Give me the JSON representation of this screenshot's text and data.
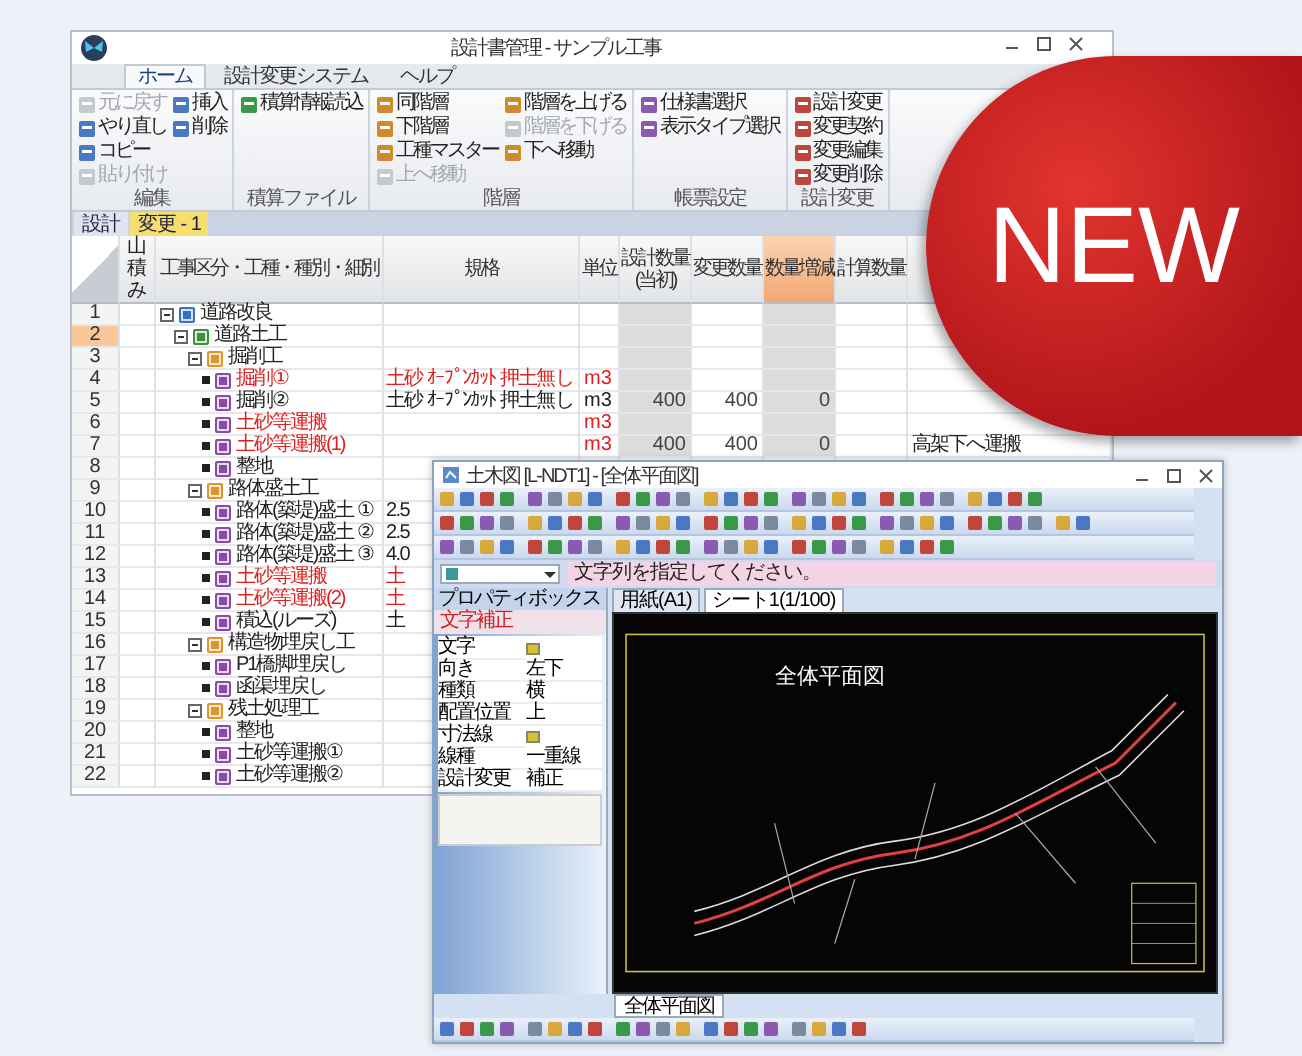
{
  "main_window": {
    "title": "設計書管理 - サンプル工事",
    "tabs": [
      {
        "label": "ホーム",
        "selected": true
      },
      {
        "label": "設計変更システム",
        "selected": false
      },
      {
        "label": "ヘルプ",
        "selected": false
      }
    ],
    "ribbon": [
      {
        "label": "編集",
        "buttons": [
          {
            "label": "元に戻す",
            "disabled": true
          },
          {
            "label": "やり直し",
            "disabled": false
          },
          {
            "label": "コピー",
            "disabled": false
          },
          {
            "label": "貼り付け",
            "disabled": true
          },
          {
            "label": "挿入",
            "disabled": false
          },
          {
            "label": "削除",
            "disabled": false
          }
        ]
      },
      {
        "label": "積算ファイル",
        "buttons": [
          {
            "label": "積算情報読込",
            "disabled": false
          }
        ]
      },
      {
        "label": "階層",
        "buttons": [
          {
            "label": "同階層",
            "disabled": false
          },
          {
            "label": "下階層",
            "disabled": false
          },
          {
            "label": "工種マスター",
            "disabled": false
          },
          {
            "label": "上へ移動",
            "disabled": true
          },
          {
            "label": "階層を上げる",
            "disabled": false
          },
          {
            "label": "階層を下げる",
            "disabled": true
          },
          {
            "label": "下へ移動",
            "disabled": false
          }
        ]
      },
      {
        "label": "帳票設定",
        "buttons": [
          {
            "label": "仕様書選択",
            "disabled": false
          },
          {
            "label": "表示タイプ選択",
            "disabled": false
          }
        ]
      },
      {
        "label": "設計変更",
        "buttons": [
          {
            "label": "設計変更",
            "disabled": false
          },
          {
            "label": "変更契約",
            "disabled": false
          },
          {
            "label": "変更編集",
            "disabled": false
          },
          {
            "label": "変更削除",
            "disabled": false
          }
        ]
      }
    ],
    "sheet_tabs": [
      {
        "label": "設計",
        "selected": false
      },
      {
        "label": "変更 - 1",
        "selected": true
      }
    ],
    "table": {
      "columns": [
        {
          "label": "山積み",
          "kind": "vertical",
          "selected": false,
          "shaded": false
        },
        {
          "label": "工事区分・工種・種別・細別",
          "kind": "text",
          "selected": false,
          "shaded": false
        },
        {
          "label": "規格",
          "kind": "text",
          "selected": false,
          "shaded": false
        },
        {
          "label": "単位",
          "kind": "text",
          "selected": false,
          "shaded": false
        },
        {
          "label": "設計数量(当初)",
          "kind": "number",
          "selected": false,
          "shaded": true
        },
        {
          "label": "変更数量",
          "kind": "number",
          "selected": false,
          "shaded": false
        },
        {
          "label": "数量増減",
          "kind": "number",
          "selected": true,
          "shaded": true
        },
        {
          "label": "計算数量",
          "kind": "number",
          "selected": false,
          "shaded": false
        }
      ],
      "rows": [
        {
          "number": "1",
          "name": "道路改良",
          "kind": "project",
          "expanded": true,
          "selected": false,
          "alert": false,
          "children": [
            {
              "number": "2",
              "name": "道路土工",
              "kind": "work",
              "expanded": true,
              "selected": true,
              "alert": false,
              "children": [
                {
                  "number": "3",
                  "name": "掘削工",
                  "kind": "group",
                  "expanded": true,
                  "selected": false,
                  "alert": false,
                  "children": [
                    {
                      "number": "4",
                      "name": "掘削①",
                      "kind": "item",
                      "selected": false,
                      "alert": true,
                      "spec": "土砂 ｵｰﾌﾟﾝｶｯﾄ 押土無し",
                      "unit": "m3"
                    },
                    {
                      "number": "5",
                      "name": "掘削②",
                      "kind": "item",
                      "selected": false,
                      "alert": false,
                      "spec": "土砂 ｵｰﾌﾟﾝｶｯﾄ 押土無し",
                      "unit": "m3",
                      "design_qty": "400",
                      "changed_qty": "400",
                      "diff": "0"
                    },
                    {
                      "number": "6",
                      "name": "土砂等運搬",
                      "kind": "item",
                      "selected": false,
                      "alert": true,
                      "unit": "m3"
                    },
                    {
                      "number": "7",
                      "name": "土砂等運搬(1)",
                      "kind": "item",
                      "selected": false,
                      "alert": true,
                      "unit": "m3",
                      "design_qty": "400",
                      "changed_qty": "400",
                      "diff": "0",
                      "note": "高架下へ運搬"
                    },
                    {
                      "number": "8",
                      "name": "整地",
                      "kind": "item",
                      "selected": false,
                      "alert": false
                    }
                  ]
                },
                {
                  "number": "9",
                  "name": "路体盛土工",
                  "kind": "group",
                  "expanded": true,
                  "selected": false,
                  "alert": false,
                  "children": [
                    {
                      "number": "10",
                      "name": "路体(築堤)盛土 ①",
                      "kind": "item",
                      "selected": false,
                      "alert": false,
                      "spec": "2.5"
                    },
                    {
                      "number": "11",
                      "name": "路体(築堤)盛土 ②",
                      "kind": "item",
                      "selected": false,
                      "alert": false,
                      "spec": "2.5"
                    },
                    {
                      "number": "12",
                      "name": "路体(築堤)盛土 ③",
                      "kind": "item",
                      "selected": false,
                      "alert": false,
                      "spec": "4.0"
                    },
                    {
                      "number": "13",
                      "name": "土砂等運搬",
                      "kind": "item",
                      "selected": false,
                      "alert": true,
                      "spec": "土"
                    },
                    {
                      "number": "14",
                      "name": "土砂等運搬(2)",
                      "kind": "item",
                      "selected": false,
                      "alert": true,
                      "spec": "土"
                    },
                    {
                      "number": "15",
                      "name": "積込(ルーズ)",
                      "kind": "item",
                      "selected": false,
                      "alert": false,
                      "spec": "土"
                    }
                  ]
                },
                {
                  "number": "16",
                  "name": "構造物埋戻し工",
                  "kind": "group",
                  "expanded": true,
                  "selected": false,
                  "alert": false,
                  "children": [
                    {
                      "number": "17",
                      "name": "P1橋脚埋戻し",
                      "kind": "item",
                      "selected": false,
                      "alert": false
                    },
                    {
                      "number": "18",
                      "name": "函渠埋戻し",
                      "kind": "item",
                      "selected": false,
                      "alert": false
                    }
                  ]
                },
                {
                  "number": "19",
                  "name": "残土処理工",
                  "kind": "group",
                  "expanded": true,
                  "selected": false,
                  "alert": false,
                  "children": [
                    {
                      "number": "20",
                      "name": "整地",
                      "kind": "item",
                      "selected": false,
                      "alert": false
                    },
                    {
                      "number": "21",
                      "name": "土砂等運搬①",
                      "kind": "item",
                      "selected": false,
                      "alert": false
                    },
                    {
                      "number": "22",
                      "name": "土砂等運搬②",
                      "kind": "item",
                      "selected": false,
                      "alert": false
                    }
                  ]
                }
              ]
            }
          ]
        }
      ]
    }
  },
  "cad_window": {
    "title": "土木図 [L-NDT1] - [全体平面図]",
    "prompt": "文字列を指定してください。",
    "properties_panel": {
      "title": "プロパティボックス",
      "command": "文字補正",
      "rows": [
        {
          "label": "文字"
        },
        {
          "label": "向き",
          "value": "左下"
        },
        {
          "label": "種類",
          "value": "横"
        },
        {
          "label": "配置位置",
          "value": "上"
        },
        {
          "label": "寸法線"
        },
        {
          "label": "線種",
          "value": "一重線"
        },
        {
          "label": "設計変更",
          "value": "補正"
        }
      ]
    },
    "drawing_tabs": [
      {
        "label": "用紙(A1)",
        "selected": false
      },
      {
        "label": "シート1(1/100)",
        "selected": true
      }
    ],
    "drawing": {
      "title": "全体平面図"
    },
    "sheet_tabs": [
      {
        "label": "全体平面図",
        "selected": true
      }
    ]
  },
  "badge": {
    "label": "NEW"
  }
}
